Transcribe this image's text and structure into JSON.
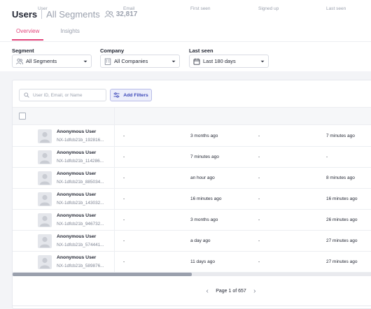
{
  "header": {
    "title": "Users",
    "segment": "All Segments",
    "count": "32,817",
    "users_icon": "users-icon"
  },
  "tabs": [
    {
      "label": "Overview",
      "active": true
    },
    {
      "label": "Insights",
      "active": false
    }
  ],
  "filters": {
    "segment": {
      "label": "Segment",
      "value": "All Segments",
      "icon": "users-icon"
    },
    "company": {
      "label": "Company",
      "value": "All Companies",
      "icon": "building-icon"
    },
    "last_seen": {
      "label": "Last seen",
      "value": "Last 180 days",
      "icon": "calendar-icon"
    }
  },
  "search": {
    "placeholder": "User ID, Email, or Name",
    "icon": "search-icon"
  },
  "add_filters": {
    "label": "Add Filters",
    "icon": "sliders-icon"
  },
  "table": {
    "columns": [
      "User",
      "Email",
      "First seen",
      "Signed up",
      "Last seen"
    ],
    "rows": [
      {
        "name": "Anonymous User",
        "id": "NX-1dfcb21b_192816...",
        "email": "-",
        "first_seen": "3 months ago",
        "signed_up": "-",
        "last_seen": "7 minutes ago"
      },
      {
        "name": "Anonymous User",
        "id": "NX-1dfcb21b_114286...",
        "email": "-",
        "first_seen": "7 minutes ago",
        "signed_up": "-",
        "last_seen": "-"
      },
      {
        "name": "Anonymous User",
        "id": "NX-1dfcb21b_885034...",
        "email": "-",
        "first_seen": "an hour ago",
        "signed_up": "-",
        "last_seen": "8 minutes ago"
      },
      {
        "name": "Anonymous User",
        "id": "NX-1dfcb21b_143032...",
        "email": "-",
        "first_seen": "16 minutes ago",
        "signed_up": "-",
        "last_seen": "16 minutes ago"
      },
      {
        "name": "Anonymous User",
        "id": "NX-1dfcb21b_946732...",
        "email": "-",
        "first_seen": "3 months ago",
        "signed_up": "-",
        "last_seen": "26 minutes ago"
      },
      {
        "name": "Anonymous User",
        "id": "NX-1dfcb21b_574441...",
        "email": "-",
        "first_seen": "a day ago",
        "signed_up": "-",
        "last_seen": "27 minutes ago"
      },
      {
        "name": "Anonymous User",
        "id": "NX-1dfcb21b_589876...",
        "email": "-",
        "first_seen": "11 days ago",
        "signed_up": "-",
        "last_seen": "27 minutes ago"
      }
    ]
  },
  "scroll": {
    "position_fraction": 0,
    "visible_fraction": 0.5
  },
  "pagination": {
    "text": "Page 1 of 657",
    "prev_icon": "chevron-left-icon",
    "next_icon": "chevron-right-icon"
  },
  "colors": {
    "accent": "#e2457b",
    "button_text": "#3b47b8",
    "background": "#f3f4f7"
  }
}
